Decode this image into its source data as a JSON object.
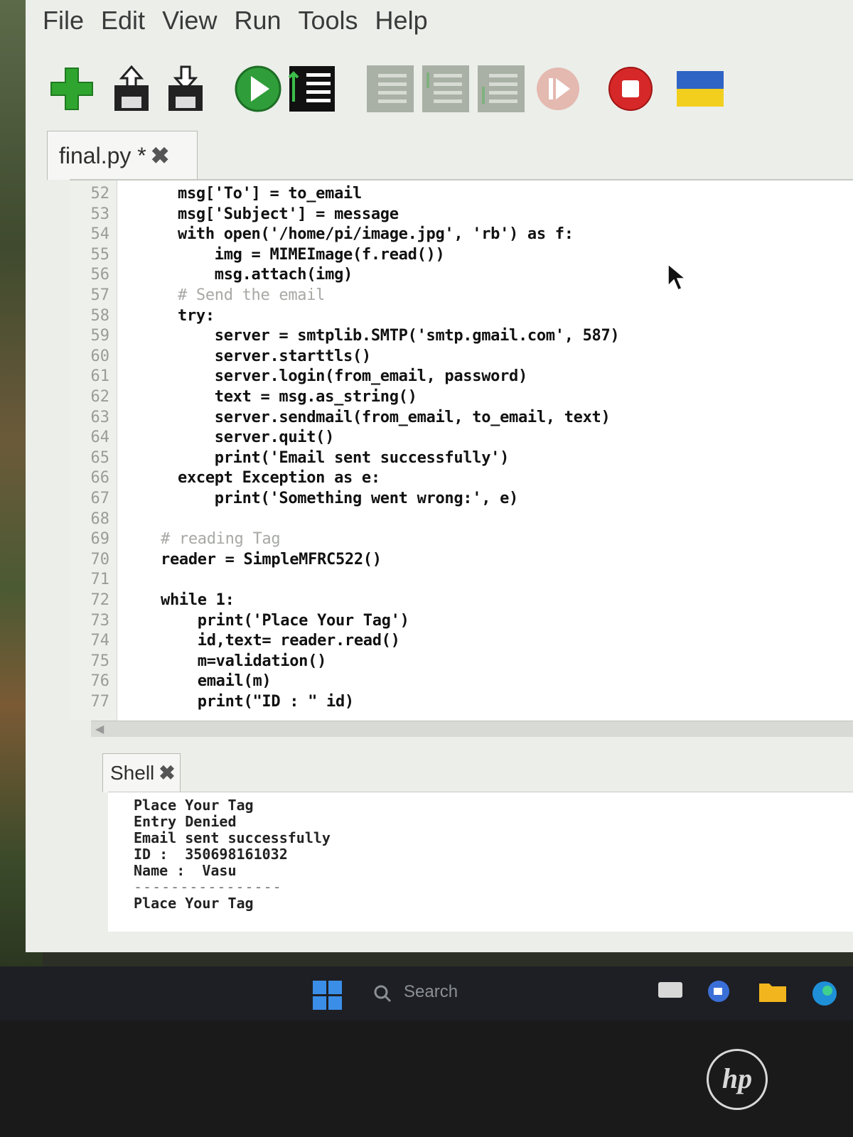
{
  "menubar": {
    "items": [
      "File",
      "Edit",
      "View",
      "Run",
      "Tools",
      "Help"
    ]
  },
  "toolbar": {
    "buttons": [
      {
        "icon": "new-file-icon",
        "color": "#2fa52f"
      },
      {
        "icon": "open-file-icon"
      },
      {
        "icon": "save-file-icon"
      },
      {
        "icon": "run-icon",
        "color": "#2f9e3a"
      },
      {
        "icon": "debug-icon"
      },
      {
        "icon": "step-over-icon",
        "state": "disabled"
      },
      {
        "icon": "step-into-icon",
        "state": "disabled"
      },
      {
        "icon": "step-out-icon",
        "state": "disabled"
      },
      {
        "icon": "resume-icon",
        "state": "disabled"
      },
      {
        "icon": "stop-icon",
        "color": "#d62828"
      },
      {
        "icon": "ukraine-flag-icon",
        "colors": [
          "#2f63c4",
          "#f2cf1d"
        ]
      }
    ]
  },
  "editor": {
    "tab_title": "final.py",
    "tab_modified": "*",
    "tab_close": "✖",
    "lines": [
      {
        "n": "52",
        "code": "msg['To'] = to_email"
      },
      {
        "n": "53",
        "code": "msg['Subject'] = message"
      },
      {
        "n": "54",
        "code": "with open('/home/pi/image.jpg', 'rb') as f:"
      },
      {
        "n": "55",
        "code": "    img = MIMEImage(f.read())"
      },
      {
        "n": "56",
        "code": "    msg.attach(img)"
      },
      {
        "n": "57",
        "code": "# Send the email"
      },
      {
        "n": "58",
        "code": "try:"
      },
      {
        "n": "59",
        "code": "    server = smtplib.SMTP('smtp.gmail.com', 587)"
      },
      {
        "n": "60",
        "code": "    server.starttls()"
      },
      {
        "n": "61",
        "code": "    server.login(from_email, password)"
      },
      {
        "n": "62",
        "code": "    text = msg.as_string()"
      },
      {
        "n": "63",
        "code": "    server.sendmail(from_email, to_email, text)"
      },
      {
        "n": "64",
        "code": "    server.quit()"
      },
      {
        "n": "65",
        "code": "    print('Email sent successfully')"
      },
      {
        "n": "66",
        "code": "except Exception as e:"
      },
      {
        "n": "67",
        "code": "    print('Something went wrong:', e)"
      },
      {
        "n": "68",
        "code": ""
      },
      {
        "n": "69",
        "code": "# reading Tag"
      },
      {
        "n": "70",
        "code": "reader = SimpleMFRC522()"
      },
      {
        "n": "71",
        "code": ""
      },
      {
        "n": "72",
        "code": "while 1:"
      },
      {
        "n": "73",
        "code": "    print('Place Your Tag')"
      },
      {
        "n": "74",
        "code": "    id,text= reader.read()"
      },
      {
        "n": "75",
        "code": "    m=validation()"
      },
      {
        "n": "76",
        "code": "    email(m)"
      },
      {
        "n": "77",
        "code": "    print(\"ID : \" id)"
      }
    ]
  },
  "shell": {
    "tab_title": "Shell",
    "tab_close": "✖",
    "lines": [
      "Place Your Tag",
      "Entry Denied",
      "Email sent successfully",
      "ID :  350698161032",
      "Name :  Vasu",
      "----------------",
      "Place Your Tag"
    ]
  },
  "taskbar": {
    "search_label": "Search",
    "tray_icons": [
      "file-explorer-icon",
      "meet-icon",
      "folder-icon",
      "edge-icon"
    ]
  },
  "device": {
    "brand": "hp"
  }
}
